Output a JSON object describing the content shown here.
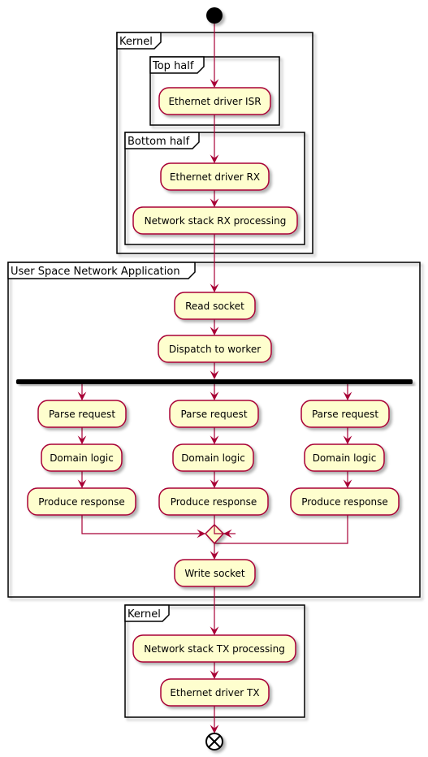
{
  "colors": {
    "node_fill": "#FEFECE",
    "node_border": "#A80036",
    "arrow": "#A80036",
    "frame": "#000000"
  },
  "frames": {
    "kernel_top": "Kernel",
    "top_half": "Top half",
    "bottom_half": "Bottom half",
    "user_space": "User Space Network Application",
    "kernel_bottom": "Kernel"
  },
  "nodes": {
    "isr": "Ethernet driver ISR",
    "rx": "Ethernet driver RX",
    "stack_rx": "Network stack RX processing",
    "read_socket": "Read socket",
    "dispatch": "Dispatch to worker",
    "branches": [
      {
        "parse": "Parse request",
        "domain": "Domain logic",
        "produce": "Produce response"
      },
      {
        "parse": "Parse request",
        "domain": "Domain logic",
        "produce": "Produce response"
      },
      {
        "parse": "Parse request",
        "domain": "Domain logic",
        "produce": "Produce response"
      }
    ],
    "write_socket": "Write socket",
    "stack_tx": "Network stack TX processing",
    "tx": "Ethernet driver TX"
  },
  "icons": {
    "start": "start-node-icon",
    "end": "end-node-icon"
  }
}
